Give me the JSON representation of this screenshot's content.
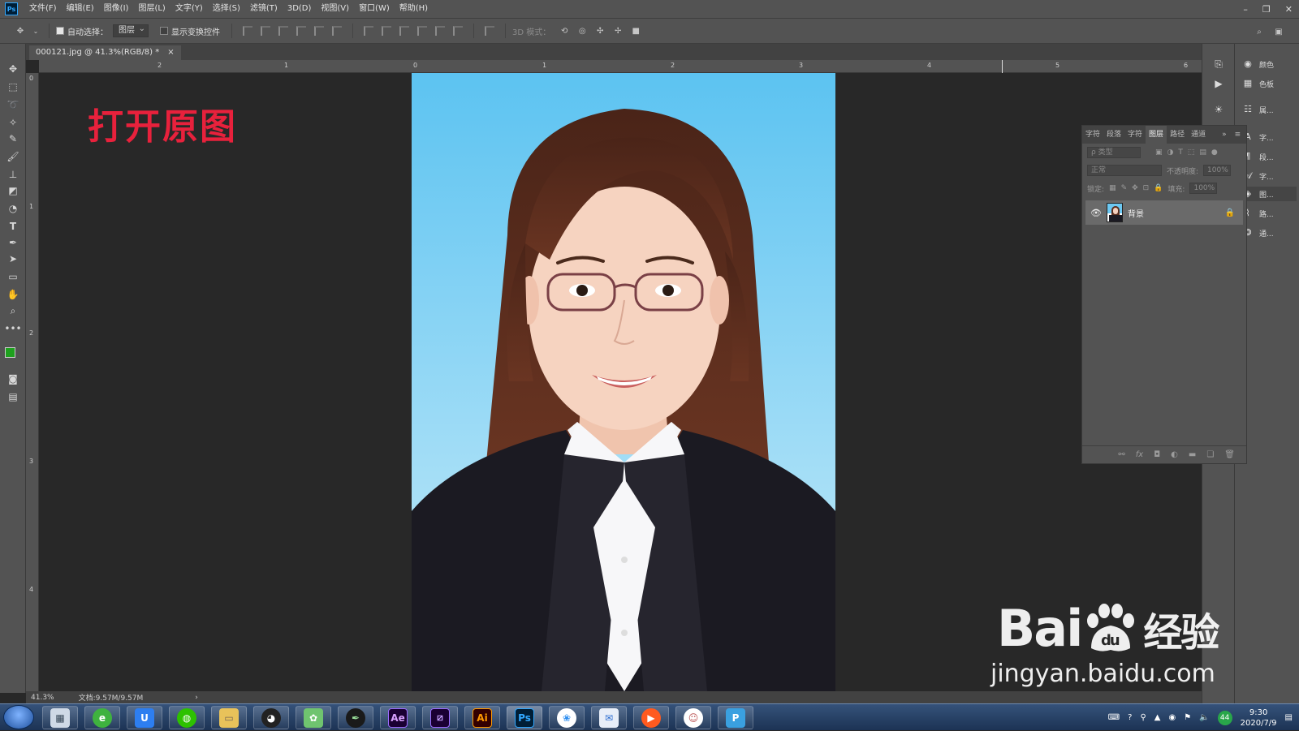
{
  "menubar": {
    "app_logo": "Ps",
    "items": [
      "文件(F)",
      "编辑(E)",
      "图像(I)",
      "图层(L)",
      "文字(Y)",
      "选择(S)",
      "滤镜(T)",
      "3D(D)",
      "视图(V)",
      "窗口(W)",
      "帮助(H)"
    ]
  },
  "options": {
    "auto_select_label": "自动选择：",
    "auto_select_checked": true,
    "auto_select_target": "图层",
    "show_transform_label": "显示变换控件",
    "show_transform_checked": false,
    "mode_3d_label": "3D 模式："
  },
  "document": {
    "tab_title": "000121.jpg @ 41.3%(RGB/8) *",
    "close": "×",
    "overlay_text": "打开原图"
  },
  "rulers": {
    "top_numbers": [
      "2",
      "1",
      "0",
      "1",
      "2",
      "3",
      "4",
      "5",
      "6"
    ],
    "left_numbers": [
      "0",
      "1",
      "2",
      "3",
      "4"
    ]
  },
  "status": {
    "zoom": "41.3%",
    "doc_size": "文档:9.57M/9.57M",
    "arrow": "›"
  },
  "layers_panel": {
    "tabs": [
      "字符",
      "段落",
      "字符",
      "图层",
      "路径",
      "通道"
    ],
    "active_tab": "图层",
    "filter_placeholder": "ρ 类型",
    "blend_mode": "正常",
    "opacity_label": "不透明度:",
    "opacity_value": "100%",
    "lock_label": "锁定:",
    "fill_label": "填充:",
    "fill_value": "100%",
    "layers": [
      {
        "name": "背景",
        "visible": true,
        "locked": true
      }
    ]
  },
  "dock": {
    "items": [
      "颜色",
      "色板",
      "属...",
      "字...",
      "段...",
      "字...",
      "图...",
      "路...",
      "通..."
    ]
  },
  "watermark": {
    "brand": "Bai",
    "brand_suffix": "经验",
    "url": "jingyan.baidu.com"
  },
  "taskbar": {
    "apps": [
      "calculator",
      "360browser",
      "uTools",
      "wechat",
      "explorer",
      "qq",
      "app-green",
      "pen",
      "Ae",
      "Pr",
      "Ai",
      "Ps",
      "app-color",
      "mail",
      "video",
      "avatar",
      "pdf"
    ],
    "clock_time": "9:30",
    "clock_date": "2020/7/9",
    "tray_badge": "44"
  },
  "colors": {
    "foreground": "#1ea01e",
    "background": "#111111",
    "ps_blue": "#31a8ff",
    "overlay_red": "#e8213c"
  }
}
